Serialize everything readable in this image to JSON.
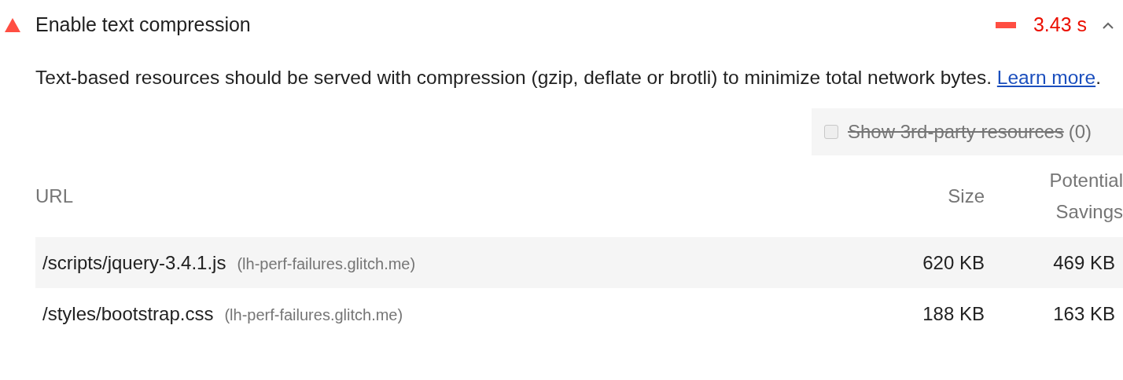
{
  "audit": {
    "title": "Enable text compression",
    "failed": true,
    "metric": "3.43 s",
    "expanded": true
  },
  "description": {
    "text": "Text-based resources should be served with compression (gzip, deflate or brotli) to minimize total network bytes.",
    "link": "Learn more",
    "after": "."
  },
  "filter": {
    "label": "Show 3rd-party resources",
    "count": "(0)",
    "checked": false,
    "disabled": true
  },
  "table": {
    "columns": [
      "URL",
      "Size",
      "Potential Savings"
    ],
    "rows": [
      {
        "url": "/scripts/jquery-3.4.1.js",
        "host": "(lh-perf-failures.glitch.me)",
        "size": "620 KB",
        "savings": "469 KB"
      },
      {
        "url": "/styles/bootstrap.css",
        "host": "(lh-perf-failures.glitch.me)",
        "size": "188 KB",
        "savings": "163 KB"
      }
    ]
  }
}
